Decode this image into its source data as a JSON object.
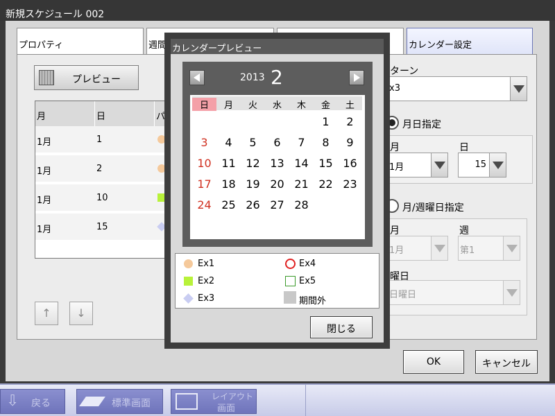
{
  "window": {
    "title": "新規スケジュール 002"
  },
  "tabs": [
    {
      "label": "プロパティ"
    },
    {
      "label": "週間"
    },
    {
      "label": ""
    },
    {
      "label": "カレンダー設定"
    }
  ],
  "left": {
    "preview_button": "プレビュー",
    "table": {
      "headers": [
        "月",
        "日",
        "パ"
      ],
      "rows": [
        {
          "month": "1月",
          "day": "1",
          "pattern": "Ex1"
        },
        {
          "month": "1月",
          "day": "2",
          "pattern": "Ex1"
        },
        {
          "month": "1月",
          "day": "10",
          "pattern": "Ex2"
        },
        {
          "month": "1月",
          "day": "15",
          "pattern": "Ex3"
        }
      ]
    },
    "move_up": "↑",
    "move_down": "↓"
  },
  "right": {
    "pattern_label": "ターン",
    "pattern_value": "x3",
    "date_mode_label": "月日指定",
    "month_label": "月",
    "day_label": "日",
    "month_value": "1月",
    "day_value": "15",
    "week_mode_label": "月/週曜日指定",
    "week_month_label": "月",
    "week_label": "週",
    "week_month_value": "1月",
    "week_value": "第1",
    "weekday_label": "曜日",
    "weekday_value": "日曜日"
  },
  "footer": {
    "ok": "OK",
    "cancel": "キャンセル"
  },
  "dialog": {
    "title": "カレンダープレビュー",
    "year": "2013",
    "month": "2",
    "weekdays": [
      "日",
      "月",
      "火",
      "水",
      "木",
      "金",
      "土"
    ],
    "weeks": [
      [
        "",
        "",
        "",
        "",
        "",
        "1",
        "2"
      ],
      [
        "3",
        "4",
        "5",
        "6",
        "7",
        "8",
        "9"
      ],
      [
        "10",
        "11",
        "12",
        "13",
        "14",
        "15",
        "16"
      ],
      [
        "17",
        "18",
        "19",
        "20",
        "21",
        "22",
        "23"
      ],
      [
        "24",
        "25",
        "26",
        "27",
        "28",
        "",
        ""
      ]
    ],
    "legend": [
      {
        "label": "Ex1",
        "icon": "filled-circle-icon",
        "color": "#f5c99b"
      },
      {
        "label": "Ex4",
        "icon": "ring-icon",
        "color": "#e02020"
      },
      {
        "label": "Ex2",
        "icon": "filled-square-icon",
        "color": "#b8f23a"
      },
      {
        "label": "Ex5",
        "icon": "outline-square-icon",
        "color": "#3a9a2a"
      },
      {
        "label": "Ex3",
        "icon": "diamond-icon",
        "color": "#c9cdf2"
      },
      {
        "label": "期間外",
        "icon": "gray-square-icon",
        "color": "#c8c8c8"
      }
    ],
    "close_button": "閉じる"
  },
  "taskbar": {
    "back": "戻る",
    "standard_view": "標準画面",
    "layout_view_line1": "レイアウト",
    "layout_view_line2": "画面"
  },
  "colors": {
    "sunday_red": "#d03020",
    "sunday_header": "#f4a0a8",
    "active_tab": "#dfe4f8",
    "taskbar": "#c7cbe8"
  }
}
